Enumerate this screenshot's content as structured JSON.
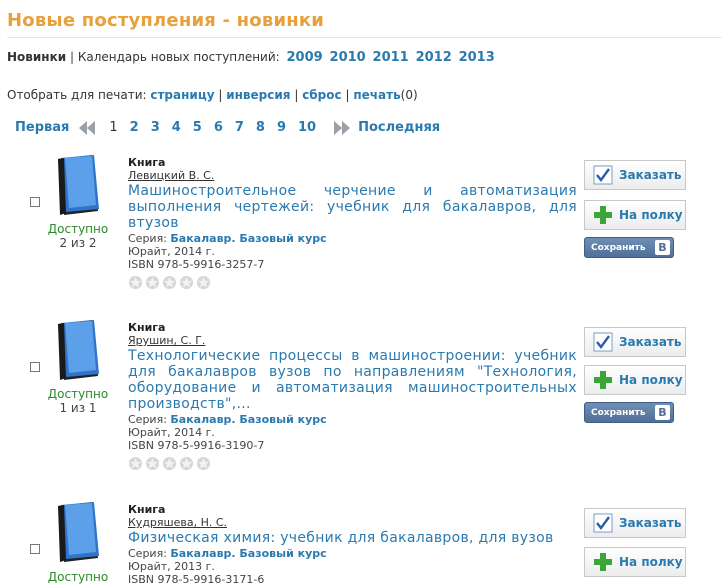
{
  "page_title": "Новые поступления - новинки",
  "nav": {
    "current": "Новинки",
    "separator": "|",
    "calendar_label": "Календарь новых поступлений:",
    "years": [
      "2009",
      "2010",
      "2011",
      "2012",
      "2013"
    ]
  },
  "print_bar": {
    "label": "Отобрать для печати:",
    "page_link": "страницу",
    "invert_link": "инверсия",
    "reset_link": "сброс",
    "print_link": "печать",
    "print_count": "(0)",
    "separator": "|"
  },
  "pager": {
    "first": "Первая",
    "last": "Последняя",
    "pages": [
      "1",
      "2",
      "3",
      "4",
      "5",
      "6",
      "7",
      "8",
      "9",
      "10"
    ],
    "current": "1"
  },
  "buttons": {
    "order": "Заказать",
    "shelf": "На полку",
    "vk_save": "Сохранить",
    "vk_letter": "B"
  },
  "icons": {
    "book": "blue-book-icon",
    "order": "checkmark-icon",
    "shelf": "green-plus-icon",
    "rating": "star-icon",
    "pager_prev": "double-arrow-left-icon",
    "pager_next": "double-arrow-right-icon"
  },
  "colors": {
    "title": "#e8a03c",
    "link": "#2a7ab0",
    "available": "#2c8a2c"
  },
  "items": [
    {
      "type": "Книга",
      "author": "Левицкий В. С.",
      "title": "Машиностроительное черчение и автоматизация выполнения чертежей: учебник для бакалавров, для втузов",
      "series_label": "Серия:",
      "series": "Бакалавр. Базовый курс",
      "publisher": "Юрайт, 2014 г.",
      "isbn": "ISBN 978-5-9916-3257-7",
      "status": "Доступно",
      "copies": "2 из 2",
      "rating": 0
    },
    {
      "type": "Книга",
      "author": "Ярушин, С. Г.",
      "title": "Технологические процессы в машиностроении: учебник для бакалавров вузов по направлениям \"Технология, оборудование и автоматизация машиностроительных производств\",...",
      "series_label": "Серия:",
      "series": "Бакалавр. Базовый курс",
      "publisher": "Юрайт, 2014 г.",
      "isbn": "ISBN 978-5-9916-3190-7",
      "status": "Доступно",
      "copies": "1 из 1",
      "rating": 0
    },
    {
      "type": "Книга",
      "author": "Кудряшева, Н. С.",
      "title": "Физическая химия: учебник для бакалавров, для вузов",
      "series_label": "Серия:",
      "series": "Бакалавр. Базовый курс",
      "publisher": "Юрайт, 2013 г.",
      "isbn": "ISBN 978-5-9916-3171-6",
      "status": "Доступно",
      "copies": "",
      "rating": 0
    }
  ]
}
